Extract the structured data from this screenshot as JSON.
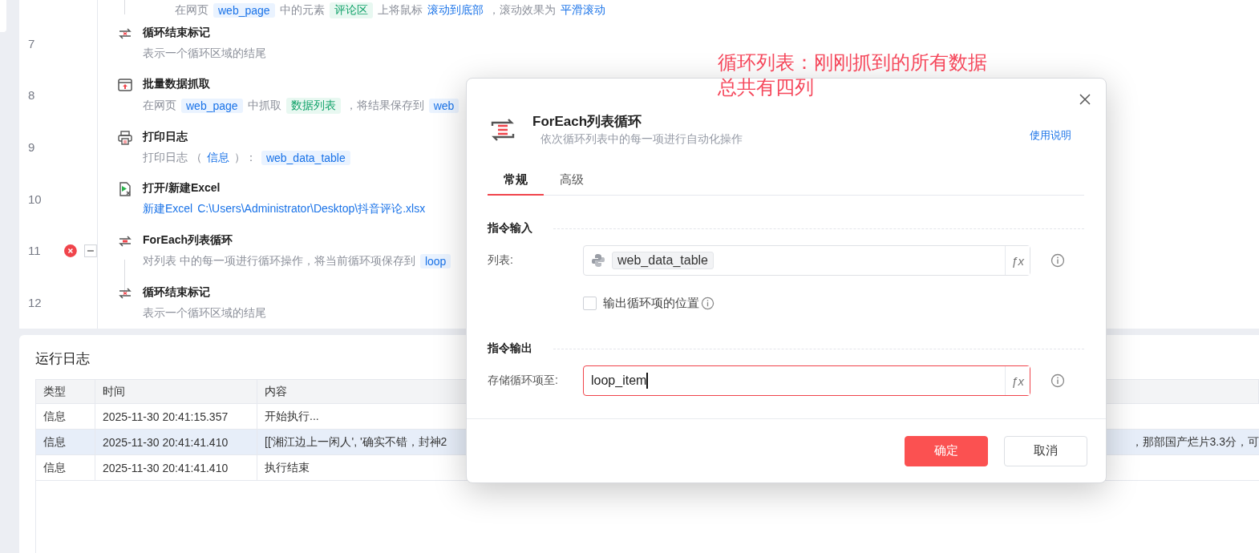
{
  "flow": {
    "steps": [
      {
        "kind": "mouse_scroll",
        "connector": true,
        "error": false,
        "desc": [
          {
            "kind": "text",
            "text": "在网页"
          },
          {
            "kind": "var",
            "text": "web_page"
          },
          {
            "kind": "text",
            "text": "中的元素"
          },
          {
            "kind": "element",
            "text": "评论区"
          },
          {
            "kind": "text",
            "text": "上将鼠标"
          },
          {
            "kind": "link",
            "text": "滚动到底部"
          },
          {
            "kind": "text",
            "text": "，滚动效果为"
          },
          {
            "kind": "link",
            "text": "平滑滚动"
          }
        ]
      },
      {
        "number": "7",
        "kind": "loop_end",
        "title": "循环结束标记",
        "connector": false,
        "error": false,
        "desc": [
          {
            "kind": "text",
            "text": "表示一个循环区域的结尾"
          }
        ]
      },
      {
        "number": "8",
        "kind": "data_scrape",
        "title": "批量数据抓取",
        "connector": false,
        "error": false,
        "desc": [
          {
            "kind": "text",
            "text": "在网页"
          },
          {
            "kind": "var",
            "text": "web_page"
          },
          {
            "kind": "text",
            "text": "中抓取"
          },
          {
            "kind": "element",
            "text": "数据列表"
          },
          {
            "kind": "text",
            "text": "，将结果保存到"
          },
          {
            "kind": "var",
            "text": "web"
          }
        ]
      },
      {
        "number": "9",
        "kind": "print_log",
        "title": "打印日志",
        "connector": false,
        "error": false,
        "desc": [
          {
            "kind": "text",
            "text": "打印日志 （"
          },
          {
            "kind": "link",
            "text": "信息"
          },
          {
            "kind": "text",
            "text": "）："
          },
          {
            "kind": "var",
            "text": "web_data_table"
          }
        ]
      },
      {
        "number": "10",
        "kind": "excel",
        "title": "打开/新建Excel",
        "connector": false,
        "error": false,
        "desc": [
          {
            "kind": "link",
            "text": "新建Excel"
          },
          {
            "kind": "link",
            "text": "C:\\Users\\Administrator\\Desktop\\抖音评论.xlsx"
          }
        ]
      },
      {
        "number": "11",
        "kind": "foreach",
        "title": "ForEach列表循环",
        "connector": true,
        "error": true,
        "expanded": true,
        "desc": [
          {
            "kind": "text",
            "text": "对列表 中的每一项进行循环操作，将当前循环项保存到"
          },
          {
            "kind": "var",
            "text": "loop"
          }
        ]
      },
      {
        "number": "12",
        "kind": "loop_end",
        "title": "循环结束标记",
        "connector": false,
        "error": false,
        "desc": [
          {
            "kind": "text",
            "text": "表示一个循环区域的结尾"
          }
        ]
      }
    ]
  },
  "log": {
    "title": "运行日志",
    "columns": [
      "类型",
      "时间",
      "内容"
    ],
    "rows": [
      {
        "type": "信息",
        "time": "2025-11-30 20:41:15.357",
        "content": "开始执行...",
        "content_tail": "",
        "selected": false
      },
      {
        "type": "信息",
        "time": "2025-11-30 20:41:41.410",
        "content": "[['湘江边上一闲人', '确实不错，封神2",
        "content_tail": "，那部国产烂片3.3分，可",
        "selected": true
      },
      {
        "type": "信息",
        "time": "2025-11-30 20:41:41.410",
        "content": "执行结束",
        "content_tail": "",
        "selected": false
      }
    ]
  },
  "annotation": {
    "lines": [
      "循环列表：刚刚抓到的所有数据",
      "总共有四列"
    ]
  },
  "dialog": {
    "title": "ForEach列表循环",
    "subtitle": "依次循环列表中的每一项进行自动化操作",
    "help_link": "使用说明",
    "tabs": [
      {
        "label": "常规",
        "selected": true
      },
      {
        "label": "高级",
        "selected": false
      }
    ],
    "sections": [
      {
        "title": "指令输入",
        "fields": [
          {
            "kind": "chip",
            "label": "列表:",
            "value": "web_data_table",
            "fx_label": "ƒx",
            "focused": false
          }
        ],
        "checkbox": {
          "label": "输出循环项的位置",
          "checked": false
        }
      },
      {
        "title": "指令输出",
        "fields": [
          {
            "kind": "text",
            "label": "存储循环项至:",
            "value": "loop_item",
            "fx_label": "ƒx",
            "focused": true
          }
        ]
      }
    ],
    "buttons": [
      {
        "label": "确定",
        "kind": "primary"
      },
      {
        "label": "取消",
        "kind": "default"
      }
    ]
  }
}
